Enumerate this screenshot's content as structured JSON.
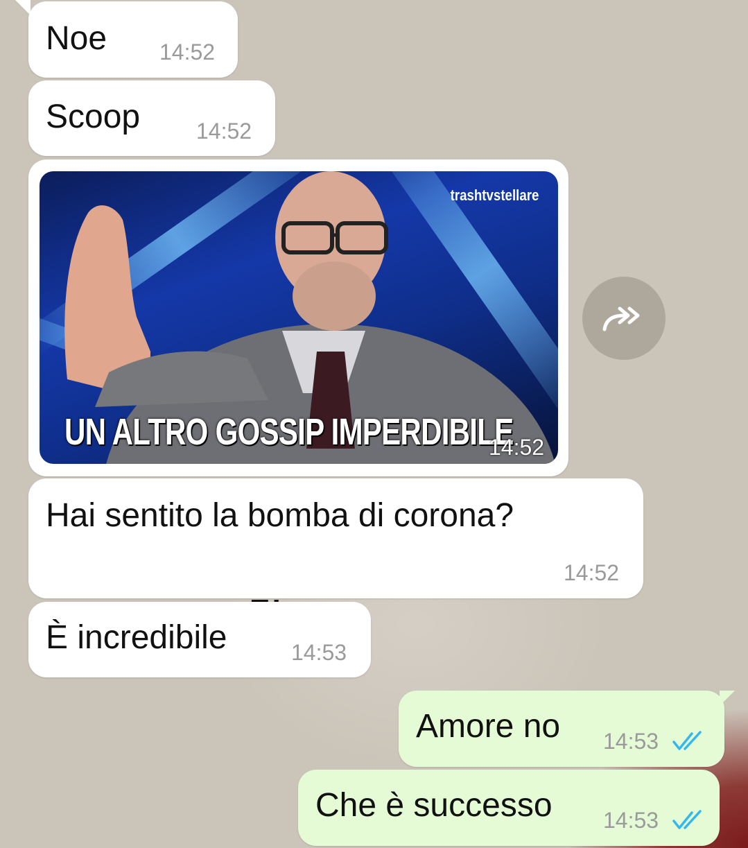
{
  "chat": {
    "messages": [
      {
        "text": "Noe",
        "time": "14:52",
        "direction": "in"
      },
      {
        "text": "Scoop",
        "time": "14:52",
        "direction": "in"
      },
      {
        "type": "gif",
        "caption": "UN ALTRO GOSSIP IMPERDIBILE",
        "watermark": "trashtvstellare",
        "time": "14:52",
        "direction": "in"
      },
      {
        "text": "Hai sentito la bomba di corona?",
        "time": "14:52",
        "direction": "in"
      },
      {
        "text": "È incredibile",
        "time": "14:53",
        "direction": "in"
      },
      {
        "text": "Amore no",
        "time": "14:53",
        "direction": "out",
        "status": "read"
      },
      {
        "text": "Che è successo",
        "time": "14:53",
        "direction": "out",
        "status": "read"
      }
    ],
    "background_text": "E!"
  },
  "icons": {
    "forward": "forward-icon",
    "read_receipt": "double-check-icon"
  },
  "colors": {
    "incoming_bubble": "#ffffff",
    "outgoing_bubble": "#e4fbd6",
    "read_ticks": "#34b7f1",
    "timestamp": "#9a9a9a"
  }
}
